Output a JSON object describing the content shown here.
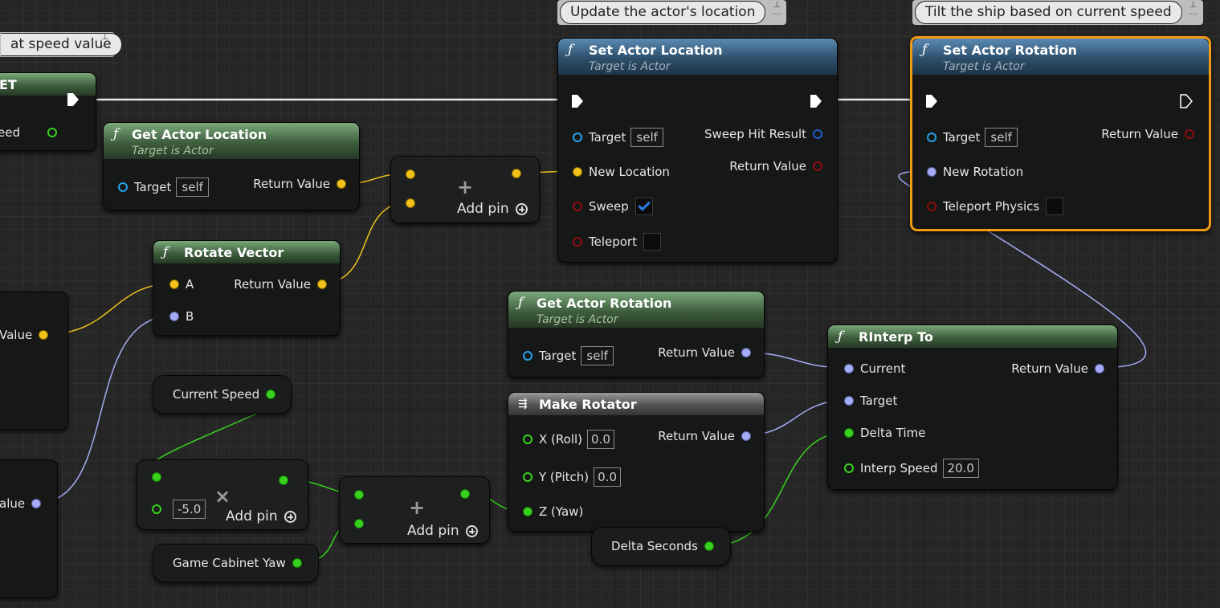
{
  "comments": {
    "speed": "at speed value",
    "location": "Update the actor's location",
    "tilt": "Tilt the ship based on current speed"
  },
  "left_partial": {
    "set_title": "ET",
    "speed_label": "eed",
    "value_label": "Value",
    "value2_label": "alue"
  },
  "get_actor_location": {
    "title": "Get Actor Location",
    "subtitle": "Target is Actor",
    "target_label": "Target",
    "target_value": "self",
    "return_label": "Return Value"
  },
  "add_vector": {
    "add_pin_label": "Add pin"
  },
  "rotate_vector": {
    "title": "Rotate Vector",
    "a_label": "A",
    "b_label": "B",
    "return_label": "Return Value"
  },
  "set_actor_location": {
    "title": "Set Actor Location",
    "subtitle": "Target is Actor",
    "target_label": "Target",
    "target_value": "self",
    "new_location_label": "New Location",
    "sweep_label": "Sweep",
    "sweep_checked": true,
    "teleport_label": "Teleport",
    "teleport_checked": false,
    "sweep_hit_label": "Sweep Hit Result",
    "return_label": "Return Value"
  },
  "set_actor_rotation": {
    "title": "Set Actor Rotation",
    "subtitle": "Target is Actor",
    "target_label": "Target",
    "target_value": "self",
    "new_rotation_label": "New Rotation",
    "teleport_physics_label": "Teleport Physics",
    "teleport_physics_checked": false,
    "return_label": "Return Value"
  },
  "get_actor_rotation": {
    "title": "Get Actor Rotation",
    "subtitle": "Target is Actor",
    "target_label": "Target",
    "target_value": "self",
    "return_label": "Return Value"
  },
  "make_rotator": {
    "title": "Make Rotator",
    "x_label": "X (Roll)",
    "x_value": "0.0",
    "y_label": "Y (Pitch)",
    "y_value": "0.0",
    "z_label": "Z (Yaw)",
    "return_label": "Return Value"
  },
  "rinterp_to": {
    "title": "RInterp To",
    "current_label": "Current",
    "target_label": "Target",
    "delta_time_label": "Delta Time",
    "interp_speed_label": "Interp Speed",
    "interp_speed_value": "20.0",
    "return_label": "Return Value"
  },
  "variables": {
    "current_speed": "Current Speed",
    "game_cabinet_yaw": "Game Cabinet Yaw",
    "delta_seconds": "Delta Seconds"
  },
  "multiply_node": {
    "value": "-5.0",
    "add_pin_label": "Add pin"
  },
  "add_float": {
    "add_pin_label": "Add pin"
  },
  "colors": {
    "exec": "#ffffff",
    "vector": "#f2c21a",
    "rotator": "#a4acf5",
    "float": "#38d21e",
    "object": "#27a2ea",
    "bool": "#8e0d0d",
    "selection": "#f19a12"
  }
}
